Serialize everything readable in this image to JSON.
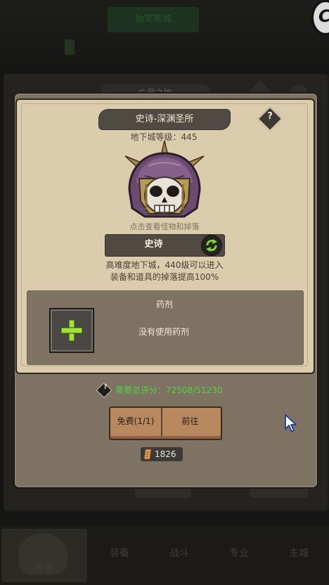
{
  "background": {
    "top_button_label": "抽奖商城",
    "panel_title": "亡灵之地",
    "bottom_buttons": [
      "",
      ""
    ],
    "tabs": [
      "勇者",
      "装备",
      "战斗",
      "专业",
      "主城"
    ]
  },
  "dialog": {
    "title": "史诗-深渊圣所",
    "level_text": "地下城等级：445",
    "boss_hint": "点击查看怪物和掉落",
    "difficulty": "史诗",
    "description_line1": "高难度地下城，440级可以进入",
    "description_line2": "装备和道具的掉落提高100%",
    "potion": {
      "title": "药剂",
      "status": "没有使用药剂"
    },
    "requirement_text": "需要总评分：72508/51230",
    "free_button_label": "免费(1/1)",
    "go_button_label": "前往",
    "scroll_count": "1826"
  },
  "colors": {
    "parchment": "#dcccae",
    "frame": "#7e7263",
    "requirement_green": "#56d043",
    "button_tan": "#b8885f"
  }
}
